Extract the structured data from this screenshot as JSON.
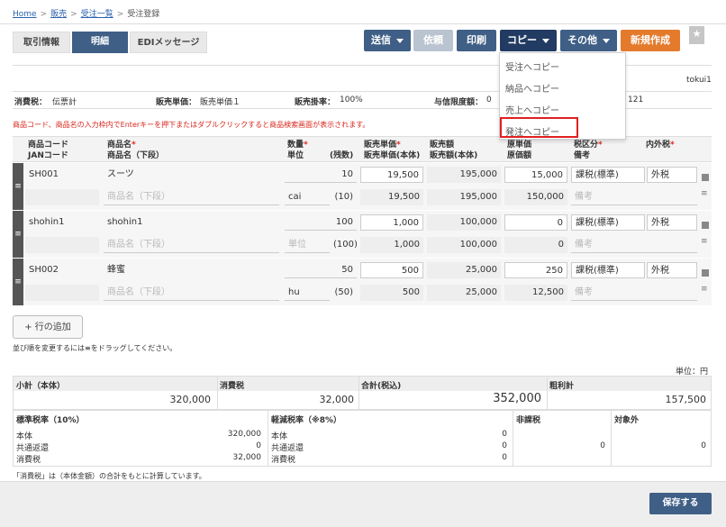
{
  "breadcrumb": {
    "home": "Home",
    "sales": "販売",
    "orders": "受注一覧",
    "current": "受注登録",
    "separator": ">"
  },
  "tabs": [
    "取引情報",
    "明細",
    "EDIメッセージ"
  ],
  "toolbar": {
    "send": "送信",
    "request": "依頼",
    "print": "印刷",
    "copy": "コピー",
    "other": "その他",
    "new": "新規作成",
    "star_icon": "star-icon"
  },
  "copy_menu": [
    "受注へコピー",
    "納品へコピー",
    "売上へコピー",
    "発注へコピー"
  ],
  "user": "tokui1",
  "info_bar": {
    "tax_label": "消費税：",
    "tax_value": "伝票計",
    "price_label": "販売単価：",
    "price_value": "販売単価１",
    "rate_label": "販売掛率：",
    "rate_value": "100%",
    "credit_label": "与信限度額：",
    "credit_value": "0",
    "extra_value": "121"
  },
  "notice": "商品コード、商品名の入力枠内でEnterキーを押下またはダブルクリックすると商品検索画面が表示されます。",
  "columns": {
    "code": "商品コード",
    "jan": "JANコード",
    "name": "商品名",
    "name_lower": "商品名（下段）",
    "qty": "数量",
    "unit": "単位",
    "rem": "(残数)",
    "price": "販売単価",
    "price_body": "販売単価(本体)",
    "amount": "販売額",
    "amount_body": "販売額(本体)",
    "cost": "原単価",
    "cost_amount": "原価額",
    "taxcat": "税区分",
    "note": "備考",
    "inout": "内外税",
    "required": "*"
  },
  "placeholders": {
    "name_lower": "商品名（下段）",
    "unit": "単位",
    "note": "備考"
  },
  "rows": [
    {
      "code": "SH001",
      "name": "スーツ",
      "qty": "10",
      "unit": "cai",
      "rem": "(10)",
      "price": "19,500",
      "price_body": "19,500",
      "amount": "195,000",
      "amount_body": "195,000",
      "cost": "15,000",
      "cost_amount": "150,000",
      "taxcat": "課税(標準)",
      "inout": "外税"
    },
    {
      "code": "shohin1",
      "name": "shohin1",
      "qty": "100",
      "unit": "",
      "rem": "(100)",
      "price": "1,000",
      "price_body": "1,000",
      "amount": "100,000",
      "amount_body": "100,000",
      "cost": "0",
      "cost_amount": "0",
      "taxcat": "課税(標準)",
      "inout": "外税"
    },
    {
      "code": "SH002",
      "name": "蜂蜜",
      "qty": "50",
      "unit": "hu",
      "rem": "(50)",
      "price": "500",
      "price_body": "500",
      "amount": "25,000",
      "amount_body": "25,000",
      "cost": "250",
      "cost_amount": "12,500",
      "taxcat": "課税(標準)",
      "inout": "外税"
    }
  ],
  "add_row": "+ 行の追加",
  "drag_hint": "並び順を変更するには≡をドラッグしてください。",
  "unit_label": "単位：円",
  "summary": {
    "subtotal_label": "小計（本体）",
    "subtotal": "320,000",
    "tax_label": "消費税",
    "tax": "32,000",
    "total_label": "合計(税込)",
    "total": "352,000",
    "profit_label": "粗利計",
    "profit": "157,500"
  },
  "breakdown": {
    "standard_label": "標準税率（10%）",
    "reduced_label": "軽減税率（※8%）",
    "nontax_label": "非課税",
    "exempt_label": "対象外",
    "body": "本体",
    "rebate": "共通返還",
    "tax": "消費税",
    "standard": [
      "320,000",
      "0",
      "32,000"
    ],
    "reduced": [
      "0",
      "0",
      "0"
    ],
    "nontax": "0",
    "exempt": "0"
  },
  "footnote": "「消費税」は（本体金額）の合計をもとに計算しています。",
  "save": "保存する"
}
